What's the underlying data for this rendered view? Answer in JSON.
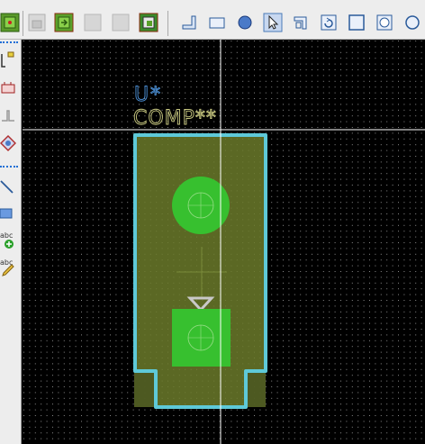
{
  "toolbar": {
    "buttons": [
      {
        "icon": "board-green-icon",
        "active": true
      },
      {
        "icon": "disabled-save-icon",
        "active": false
      },
      {
        "icon": "board-arrow-icon",
        "active": true
      },
      {
        "icon": "disabled-blank-icon",
        "active": false
      },
      {
        "icon": "disabled-blank-icon",
        "active": false
      },
      {
        "icon": "export-board-icon",
        "active": true
      },
      {
        "icon": "pad-anchor-icon",
        "active": true
      },
      {
        "icon": "rect-pad-icon",
        "active": true
      },
      {
        "icon": "circle-pad-icon",
        "active": true
      },
      {
        "icon": "select-arrow-icon",
        "active": true
      },
      {
        "icon": "corner-icon",
        "active": true
      },
      {
        "icon": "rotate-icon",
        "active": true
      },
      {
        "icon": "square-outline-icon",
        "active": true
      },
      {
        "icon": "pad-circle-square-icon",
        "active": true
      },
      {
        "icon": "round-pad-icon",
        "active": true
      }
    ]
  },
  "left_toolbar": {
    "tools": [
      {
        "icon": "cursor-pin-icon"
      },
      {
        "icon": "component-icon"
      },
      {
        "icon": "pin-icon"
      },
      {
        "icon": "diamond-pad-icon"
      },
      {
        "icon": "line-icon"
      },
      {
        "icon": "rectangle-icon"
      },
      {
        "icon": "add-text-icon",
        "label": "abc"
      },
      {
        "icon": "edit-text-icon",
        "label": "abc"
      }
    ]
  },
  "canvas": {
    "reference_text": "U*",
    "value_text": "COMP**",
    "colors": {
      "background": "#000000",
      "grid": "#8a8a8a",
      "outline": "#5ec9d8",
      "fill": "#6b7a2a",
      "pad": "#37c02f",
      "cursor": "#ffffff",
      "ref_text": "#4a8fd6",
      "value_text": "#c8c880"
    }
  }
}
